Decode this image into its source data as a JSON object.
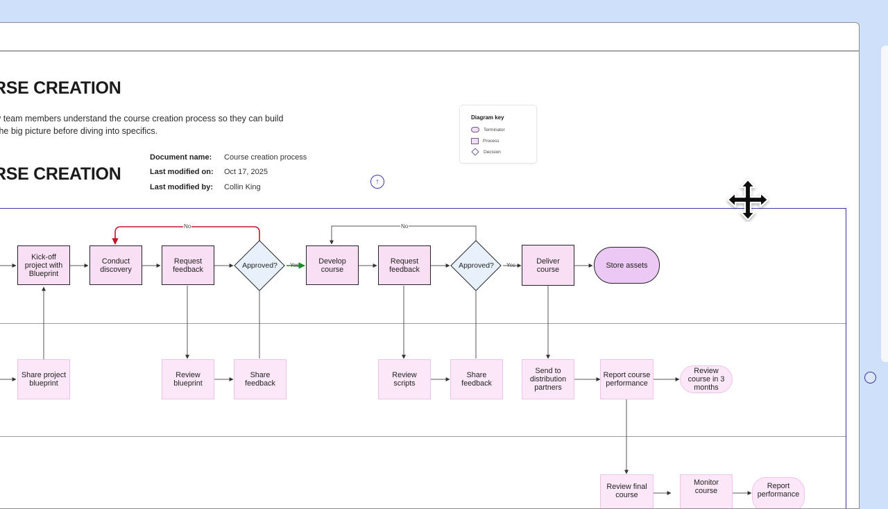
{
  "document": {
    "title_top": "RSE CREATION",
    "intro_line1": "v team members understand the course creation process so they can build",
    "intro_line2": " the big picture before diving into specifics.",
    "title_second": "RSE CREATION",
    "meta": {
      "name_label": "Document name:",
      "name_value": "Course creation process",
      "modified_label": "Last modified on:",
      "modified_value": "Oct 17, 2025",
      "by_label": "Last modified by:",
      "by_value": "Collin King"
    },
    "scroll_top_symbol": "↑"
  },
  "key": {
    "title": "Diagram key",
    "items": [
      "Terminator",
      "Process",
      "Decision"
    ]
  },
  "diagram": {
    "lane1": {
      "kickoff": "Kick-off project with Blueprint",
      "discovery": "Conduct discovery",
      "request1": "Request feedback",
      "approved1": "Approved?",
      "develop": "Develop course",
      "request2": "Request feedback",
      "approved2": "Approved?",
      "deliver": "Deliver course",
      "store": "Store assets"
    },
    "lane2": {
      "share_blueprint": "Share project blueprint",
      "review_blueprint": "Review blueprint",
      "share_feedback1": "Share feedback",
      "review_scripts": "Review scripts",
      "share_feedback2": "Share feedback",
      "send_distribution": "Send to distribution partners",
      "report_performance": "Report course performance",
      "review_3months": "Review course in 3 months"
    },
    "lane3": {
      "review_final": "Review final course",
      "monitor": "Monitor course",
      "report_perf2": "Report performance"
    },
    "labels": {
      "no": "No",
      "yes": "Yes"
    },
    "colors": {
      "frame": "#3a33a1",
      "reject_edge": "#c0152a",
      "yes_edge": "#1f8a2a"
    }
  }
}
